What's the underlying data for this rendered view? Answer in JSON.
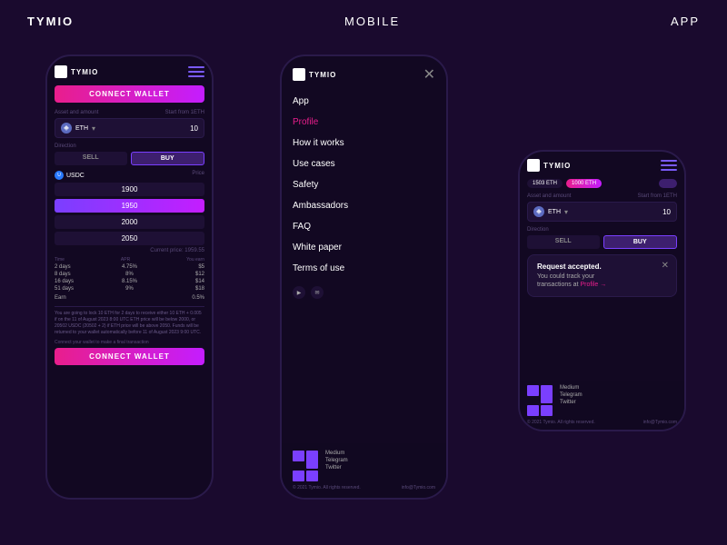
{
  "nav": {
    "brand": "TYMIO",
    "center": "MOBILE",
    "right": "APP"
  },
  "phoneLeft": {
    "logo": "TYMIO",
    "connectWallet": "CONNECT WALLET",
    "assetLabel": "Asset and amount",
    "startFrom": "Start from 1ETH",
    "assetName": "ETH",
    "assetValue": "10",
    "directionLabel": "Direction",
    "sellLabel": "SELL",
    "buyLabel": "BUY",
    "usdcLabel": "USDC",
    "priceLabel": "Price",
    "prices": [
      "1900",
      "1950",
      "2000",
      "2050"
    ],
    "currentPrice": "Current price: 1959.55",
    "tableHeaders": [
      "Time",
      "APR",
      "You earn"
    ],
    "tableRows": [
      {
        "time": "2 days",
        "apr": "4.75%",
        "earn": "$5"
      },
      {
        "time": "8 days",
        "apr": "8%",
        "earn": "$12"
      },
      {
        "time": "16 days",
        "apr": "8.15%",
        "earn": "$14"
      },
      {
        "time": "51 days",
        "apr": "9%",
        "earn": "$18"
      }
    ],
    "earnLabel": "Earn",
    "earnValue": "0.5%",
    "infoText": "You are going to lock 10 ETH for 2 days to receive either 10 ETH + 0.005 if on the 11 of August 2023 8:00 UTC ETH price will be below 2000, or 20502 USDC (20502 + 2) if ETH price will be above 2050. Funds will be returned to your wallet automatically before 11 of August 2023 9:00 UTC.",
    "connectLabel": "Connect your wallet to make a final transaction",
    "connectBtn": "CONNECT WALLET"
  },
  "phoneMiddle": {
    "logo": "TYMIO",
    "menuItems": [
      {
        "label": "App",
        "active": false
      },
      {
        "label": "Profile",
        "active": true
      },
      {
        "label": "How it works",
        "active": false
      },
      {
        "label": "Use cases",
        "active": false
      },
      {
        "label": "Safety",
        "active": false
      },
      {
        "label": "Ambassadors",
        "active": false
      },
      {
        "label": "FAQ",
        "active": false
      },
      {
        "label": "White paper",
        "active": false
      },
      {
        "label": "Terms of use",
        "active": false
      }
    ],
    "footerLinks": [
      "Medium",
      "Telegram",
      "Twitter"
    ],
    "copyright": "© 2021 Tymio. All rights reserved.",
    "email": "info@Tymio.com"
  },
  "phoneRight": {
    "logo": "TYMIO",
    "statusPills": [
      "1503 ETH",
      "1000 ETH"
    ],
    "assetLabel": "Asset and amount",
    "startFrom": "Start from 1ETH",
    "assetName": "ETH",
    "assetValue": "10",
    "directionLabel": "Direction",
    "sellLabel": "SELL",
    "buyLabel": "BUY",
    "notification": {
      "title": "Request accepted.",
      "text": "You could track your transactions at Profile →"
    },
    "footerLinks": [
      "Medium",
      "Telegram",
      "Twitter"
    ],
    "copyright": "© 2021 Tymio. All rights reserved.",
    "email": "info@Tymio.com"
  }
}
